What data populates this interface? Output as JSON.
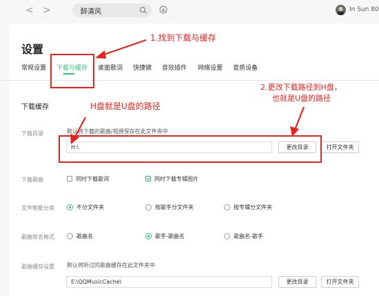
{
  "topbar": {
    "back_arrow": "<",
    "forward_arrow": ">",
    "search_value": "醉清风",
    "username": "In Sun 80"
  },
  "page": {
    "title": "设置"
  },
  "tabs": [
    {
      "label": "常规设置"
    },
    {
      "label": "下载与缓存"
    },
    {
      "label": "桌面歌词"
    },
    {
      "label": "快捷键"
    },
    {
      "label": "音效插件"
    },
    {
      "label": "网络设置"
    },
    {
      "label": "音质设备"
    }
  ],
  "section": {
    "title": "下载缓存"
  },
  "download_dir": {
    "label": "下载目录",
    "desc": "默认将下载的歌曲/视频保存在此文件夹中",
    "path": "H:\\",
    "change_btn": "更改目录",
    "open_btn": "打开文件夹"
  },
  "download_song": {
    "label": "下载歌曲",
    "opt1": "同时下载歌词",
    "opt1_checked": false,
    "opt2": "同时下载专辑图片",
    "opt2_checked": true
  },
  "folder_classify": {
    "label": "文件智能分类",
    "options": [
      "不分文件夹",
      "按歌手分文件夹",
      "按专辑分文件夹"
    ],
    "selected": "不分文件夹"
  },
  "song_naming": {
    "label": "歌曲命名格式",
    "options": [
      "歌曲名",
      "歌手-歌曲名",
      "歌曲名-歌手"
    ],
    "selected": "歌手-歌曲名"
  },
  "cache_settings": {
    "label": "歌曲缓存设置",
    "desc": "默认将听过的歌曲缓存在此文件夹中",
    "path": "E:\\QQMusicCache\\",
    "change_btn": "更改目录",
    "open_btn": "打开文件夹"
  },
  "annotations": {
    "step1": "1.找到下载与缓存",
    "step2_line1": "2.更改下载路径到H盘，",
    "step2_line2": "也就是U盘的路径",
    "hdisk_note": "H盘就是U盘的路径",
    "color": "#e8231e"
  },
  "colors": {
    "accent": "#31c27c",
    "annotation": "#e8231e"
  }
}
